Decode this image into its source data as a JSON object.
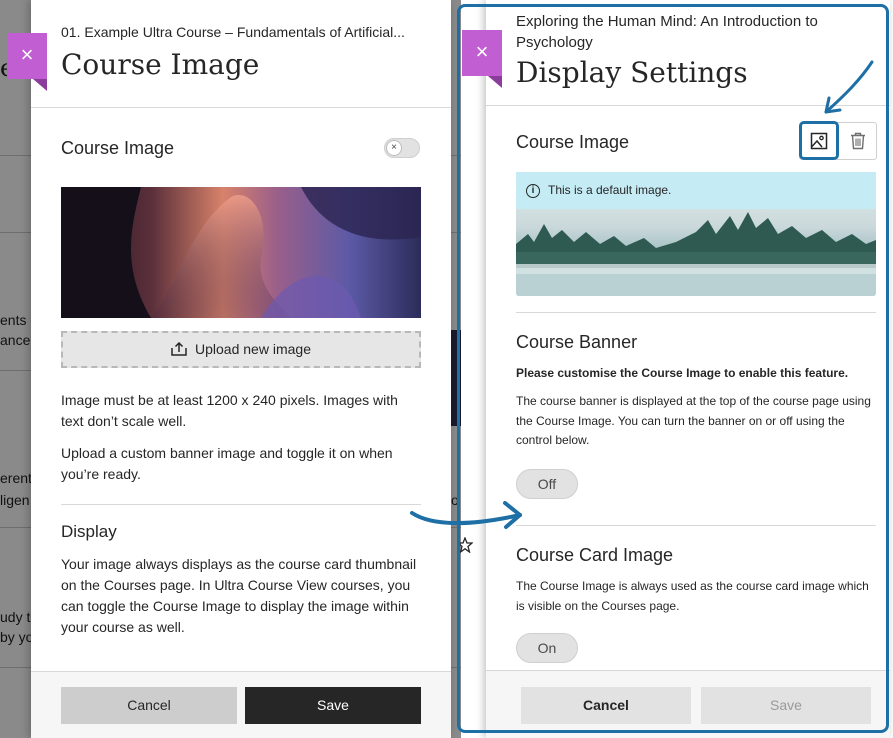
{
  "background": {
    "text_fragments": [
      "e.",
      "ents",
      "ance",
      "erent",
      "ligen",
      "o",
      "udy t",
      "by yo"
    ]
  },
  "left_panel": {
    "course_name": "01. Example Ultra Course – Fundamentals of Artificial...",
    "title": "Course Image",
    "close_label": "×",
    "section_title": "Course Image",
    "toggle_state": "off",
    "toggle_glyph": "×",
    "upload_label": "Upload new image",
    "help_1": "Image must be at least 1200 x 240 pixels. Images with text don’t scale well.",
    "help_2": "Upload a custom banner image and toggle it on when you’re ready.",
    "display_title": "Display",
    "display_text": "Your image always displays as the course card thumbnail on the Courses page. In Ultra Course View courses, you can toggle the Course Image to display the image within your course as well.",
    "cancel_label": "Cancel",
    "save_label": "Save"
  },
  "right_panel": {
    "course_name": "Exploring the Human Mind: An Introduction to Psychology",
    "title": "Display Settings",
    "close_label": "×",
    "course_image_title": "Course Image",
    "info_text": "This is a default image.",
    "info_glyph": "i",
    "banner_title": "Course Banner",
    "banner_bold": "Please customise the Course Image to enable this feature.",
    "banner_text": "The course banner is displayed at the top of the course page using the Course Image. You can turn the banner on or off using the control below.",
    "banner_toggle": "Off",
    "card_title": "Course Card Image",
    "card_text": "The Course Image is always used as the course card image which is visible on the Courses page.",
    "card_toggle": "On",
    "cancel_label": "Cancel",
    "save_label": "Save"
  },
  "colors": {
    "accent_purple": "#c15ed1",
    "highlight_blue": "#1e6fa6",
    "info_bg": "#c5ebf5",
    "save_dark": "#262626"
  },
  "icons": [
    "close-icon",
    "upload-icon",
    "image-icon",
    "trash-icon",
    "info-icon",
    "star-icon",
    "arrow-icon"
  ]
}
